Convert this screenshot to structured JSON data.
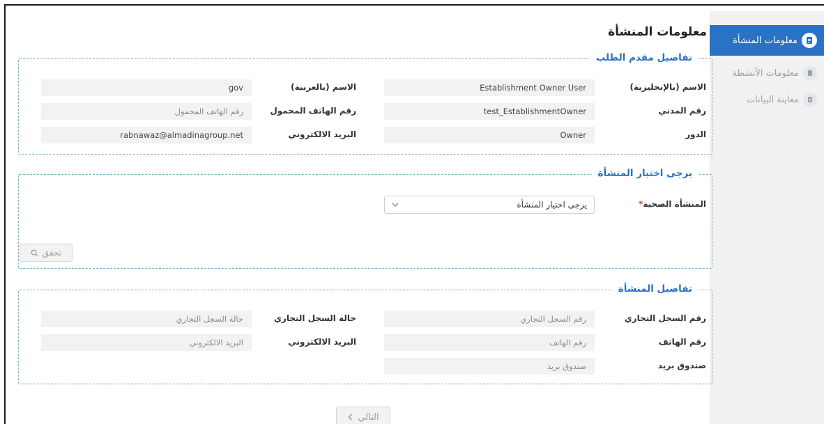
{
  "sidebar": {
    "items": [
      {
        "label": "معلومات المنشأة",
        "icon": "document-icon",
        "active": true
      },
      {
        "label": "معلومات الأنشطة",
        "icon": "clipboard-icon",
        "active": false
      },
      {
        "label": "معاينة البيانات",
        "icon": "clipboard-check-icon",
        "active": false
      }
    ]
  },
  "page_title": "معلومات المنشأة",
  "applicant": {
    "legend": "تفاصيل مقدم الطلب",
    "name_en_label": "الاسم (بالإنجليزية)",
    "name_en_value": "Establishment Owner User",
    "name_ar_label": "الاسم (بالعربية)",
    "name_ar_value": "gov",
    "civil_label": "رقم المدني",
    "civil_value": "test_EstablishmentOwner",
    "mobile_label": "رقم الهاتف المحمول",
    "mobile_placeholder": "رقم الهاتف المحمول",
    "role_label": "الدور",
    "role_value": "Owner",
    "email_label": "البريد الالكتروني",
    "email_value": "rabnawaz@almadinagroup.net"
  },
  "choose": {
    "legend": "يرجى اختيار المنشأة",
    "facility_label": "المنشأة الصحية",
    "required_mark": "*",
    "select_value": "يرجى اختيار المنشأة",
    "verify_label": "تحقق"
  },
  "establishment": {
    "legend": "تفاصيل المنشأة",
    "cr_label": "رقم السجل التجاري",
    "cr_placeholder": "رقم السجل التجاري",
    "cr_status_label": "حالة السجل التجاري",
    "cr_status_placeholder": "حالة السجل التجاري",
    "phone_label": "رقم الهاتف",
    "phone_placeholder": "رقم الهاتف",
    "email_label": "البريد الالكتروني",
    "email_placeholder": "البريد الالكتروني",
    "po_label": "صندوق بريد",
    "po_placeholder": "صندوق بريد"
  },
  "next_label": "التالي",
  "colors": {
    "accent": "#2a72c6",
    "border": "#6fb0c8",
    "field": "#f2f2f2"
  }
}
